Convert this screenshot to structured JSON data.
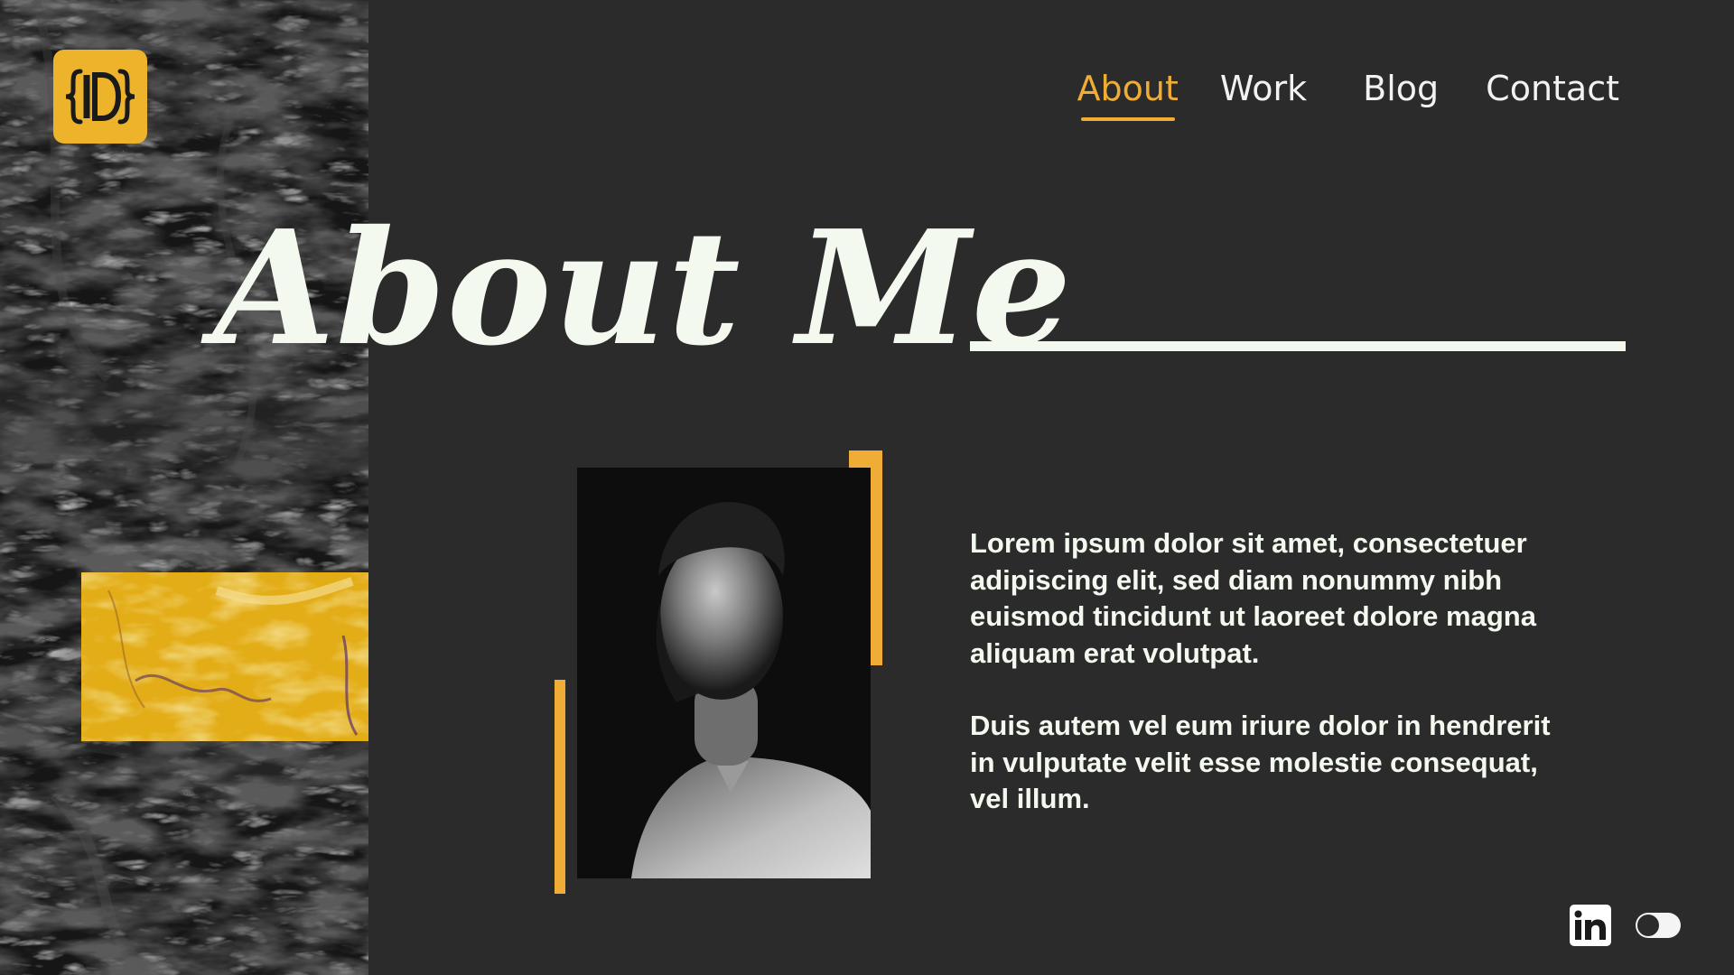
{
  "brand": {
    "logo_text": "{ID}",
    "accent_color": "#efac37",
    "logo_color": "#edb42b",
    "background_color": "#2b2b2b",
    "text_color": "#f3f9ee"
  },
  "nav": {
    "items": [
      {
        "label": "About",
        "active": true
      },
      {
        "label": "Work",
        "active": false
      },
      {
        "label": "Blog",
        "active": false
      },
      {
        "label": "Contact",
        "active": false
      }
    ]
  },
  "hero": {
    "title": "About Me"
  },
  "bio": {
    "paragraphs": [
      "Lorem ipsum dolor sit amet, consectetuer adipiscing elit, sed diam nonummy nibh euismod tincidunt ut laoreet dolore magna aliquam erat volutpat.",
      "Duis autem vel eum iriure dolor in hendrerit in vulputate velit esse molestie consequat, vel illum."
    ]
  },
  "social": {
    "icons": [
      "linkedin-icon"
    ]
  },
  "theme_toggle": {
    "state": "dark"
  }
}
